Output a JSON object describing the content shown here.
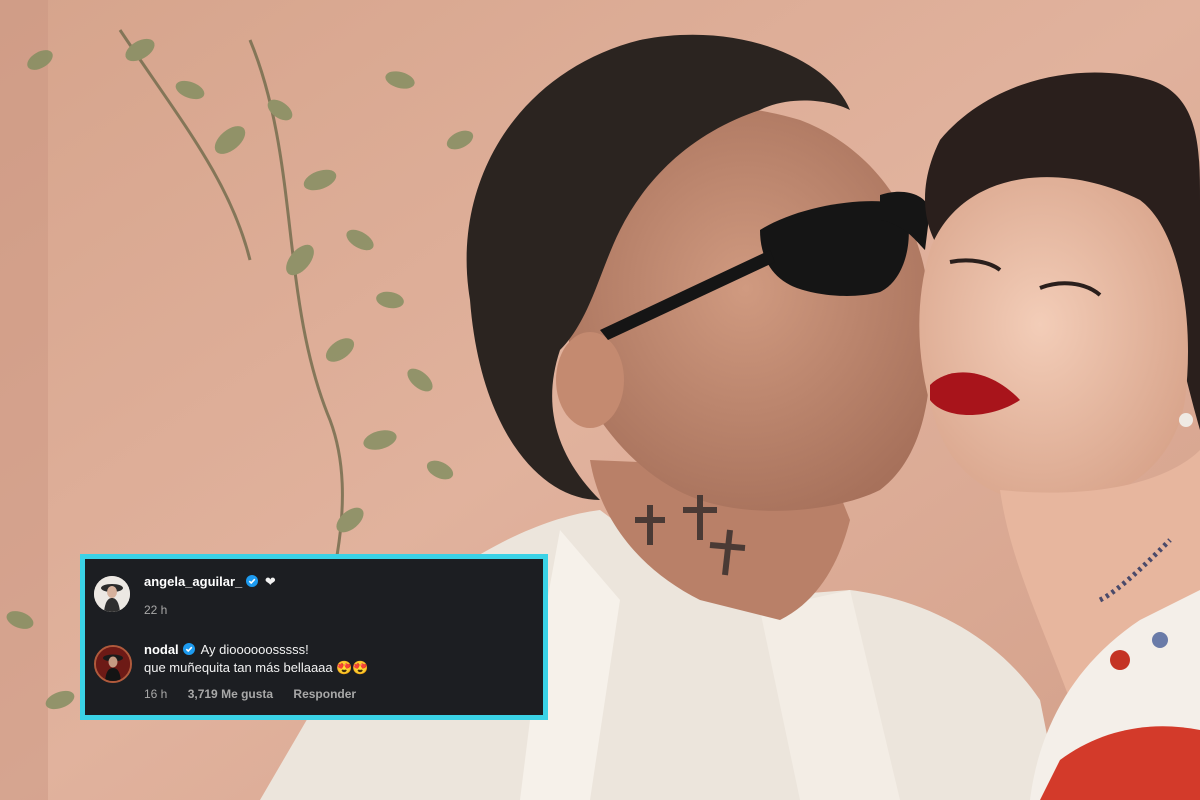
{
  "comments": [
    {
      "username": "angela_aguilar_",
      "text": "❤",
      "time": "22 h",
      "verified": true,
      "avatar_icon": "profile-photo-angela"
    },
    {
      "username": "nodal",
      "text": "Ay dioooooosssss!",
      "text_line2": "que muñequita tan más bellaaaa 😍😍",
      "time": "16 h",
      "likes": "3,719 Me gusta",
      "reply": "Responder",
      "verified": true,
      "avatar_icon": "profile-photo-nodal"
    }
  ],
  "colors": {
    "card_border": "#3ad2e6",
    "card_background": "#1c1e22",
    "verified_badge": "#1d9bf0"
  }
}
